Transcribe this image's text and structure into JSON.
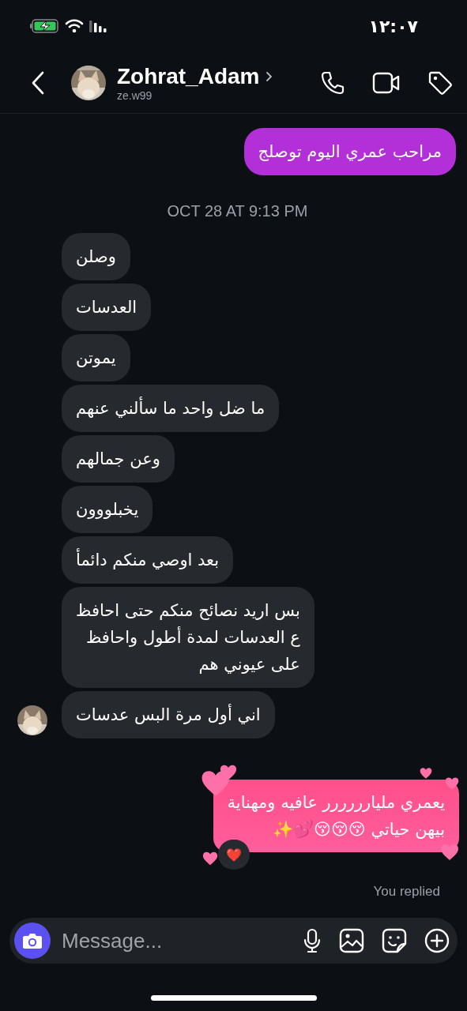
{
  "status_bar": {
    "time": "١٢:٠٧"
  },
  "header": {
    "name": "Zohrat_Adam",
    "username": "ze.w99"
  },
  "messages": [
    {
      "kind": "sent",
      "text": "مراحب عمري اليوم توصلج"
    },
    {
      "kind": "date",
      "text": "OCT 28 AT 9:13 PM"
    },
    {
      "kind": "received",
      "text": "وصلن",
      "avatar": false
    },
    {
      "kind": "received",
      "text": "العدسات",
      "avatar": false
    },
    {
      "kind": "received",
      "text": "يموتن",
      "avatar": false
    },
    {
      "kind": "received",
      "text": "ما ضل واحد ما سألني عنهم",
      "avatar": false
    },
    {
      "kind": "received",
      "text": "وعن جمالهم",
      "avatar": false
    },
    {
      "kind": "received",
      "text": "يخبلووون",
      "avatar": false
    },
    {
      "kind": "received",
      "text": "بعد اوصي منكم دائمأ",
      "avatar": false
    },
    {
      "kind": "received",
      "text": "بس اريد نصائح منكم حتى احافظ\nع العدسات لمدة أطول واحافظ\nعلى عيوني هم",
      "avatar": false
    },
    {
      "kind": "received",
      "text": "اني أول مرة البس عدسات",
      "avatar": true
    },
    {
      "kind": "sent_effect",
      "text": "يعمري مليارررررر عافيه ومهناية\nبيهن حياتي 😚😚😚💕✨",
      "reaction": "❤️"
    },
    {
      "kind": "note",
      "text": "You replied"
    }
  ],
  "composer": {
    "placeholder": "Message..."
  }
}
